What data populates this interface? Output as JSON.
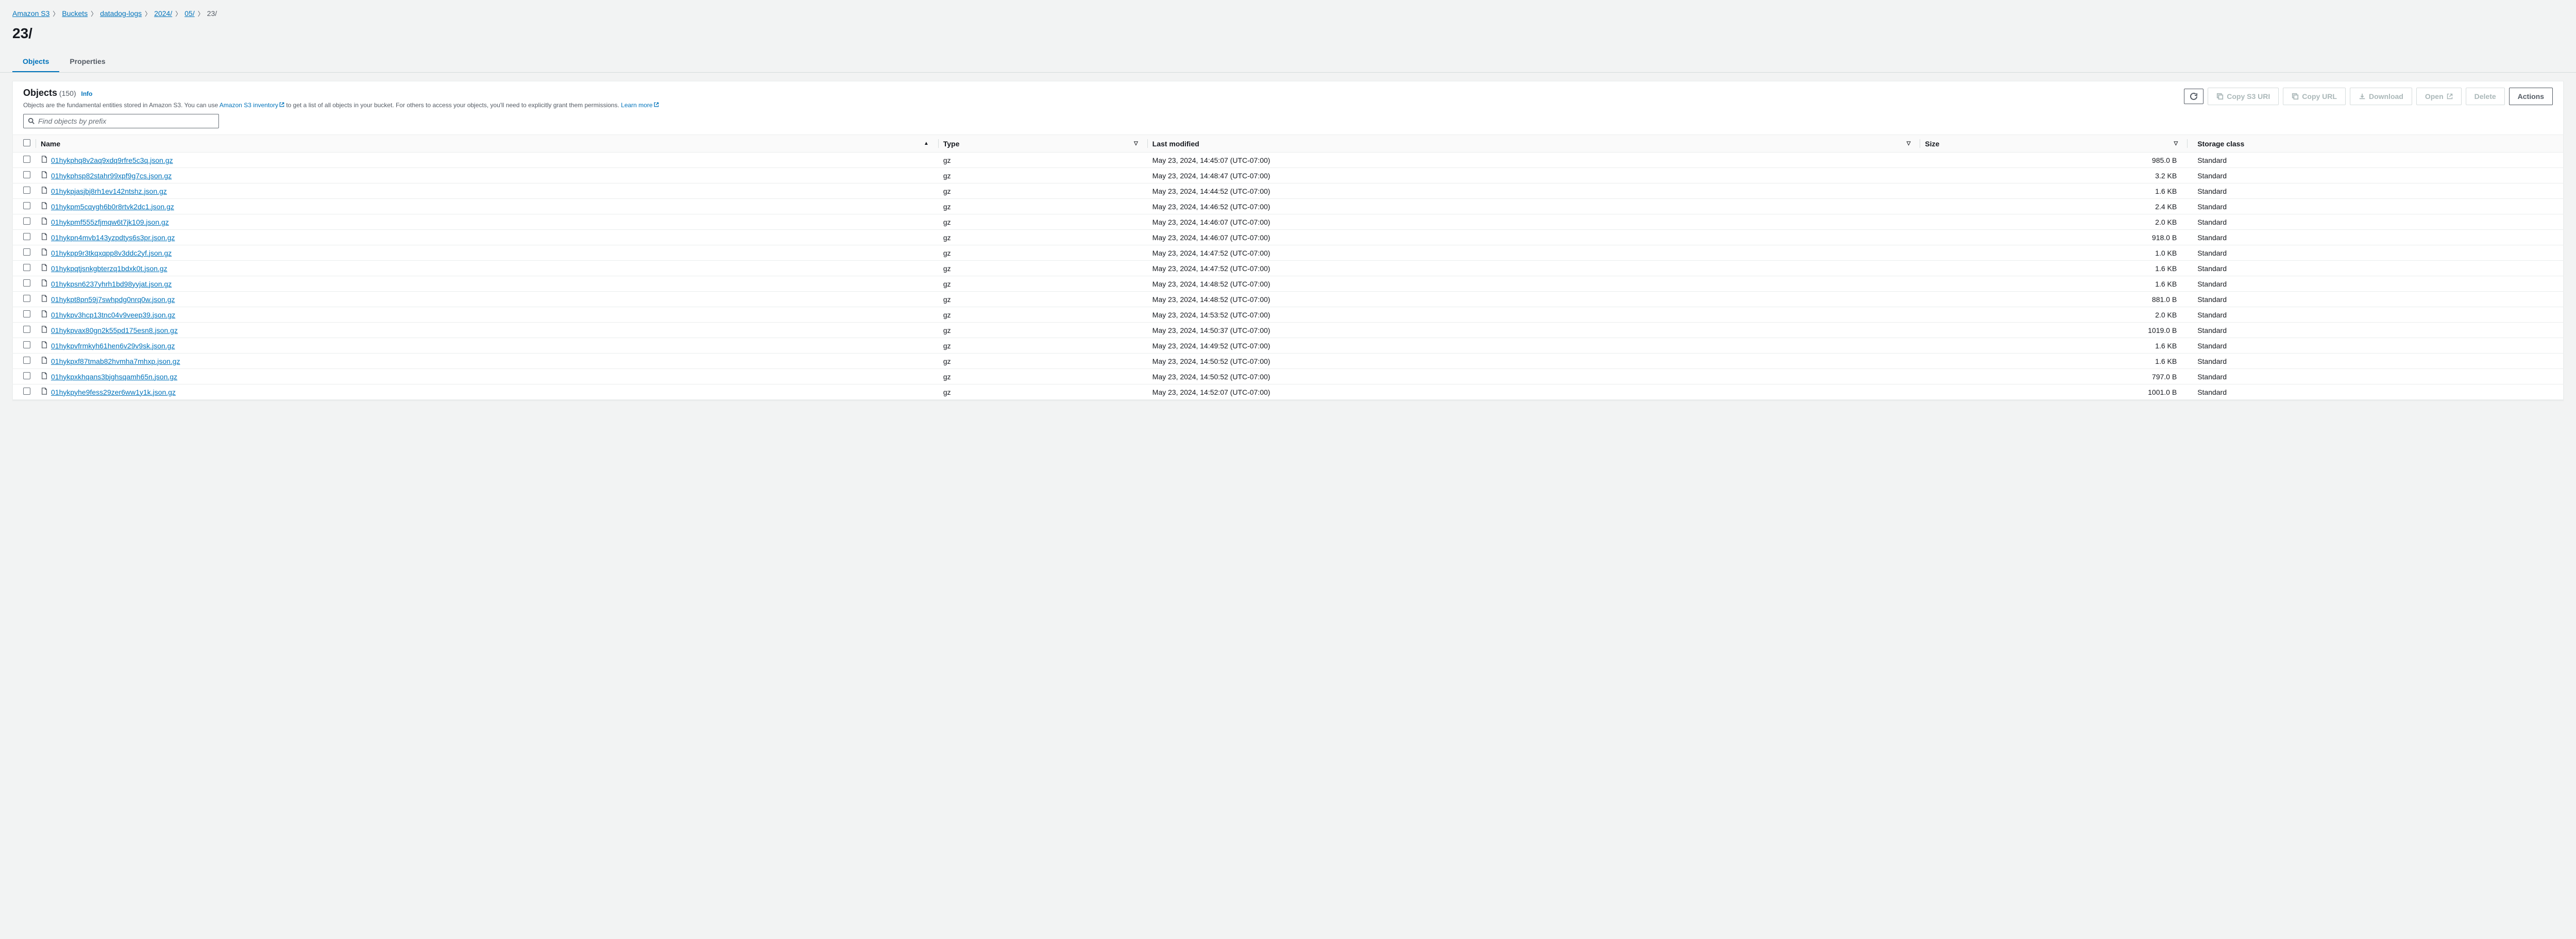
{
  "breadcrumb": [
    {
      "label": "Amazon S3",
      "link": true
    },
    {
      "label": "Buckets",
      "link": true
    },
    {
      "label": "datadog-logs",
      "link": true
    },
    {
      "label": "2024/",
      "link": true
    },
    {
      "label": "05/",
      "link": true
    },
    {
      "label": "23/",
      "link": false
    }
  ],
  "page_title": "23/",
  "tabs": {
    "objects": "Objects",
    "properties": "Properties"
  },
  "panel": {
    "title": "Objects",
    "count": "(150)",
    "info": "Info",
    "desc_pre": "Objects are the fundamental entities stored in Amazon S3. You can use ",
    "desc_link1": "Amazon S3 inventory",
    "desc_mid": " to get a list of all objects in your bucket. For others to access your objects, you'll need to explicitly grant them permissions. ",
    "desc_link2": "Learn more"
  },
  "actions": {
    "copy_s3_uri": "Copy S3 URI",
    "copy_url": "Copy URL",
    "download": "Download",
    "open": "Open",
    "delete": "Delete",
    "actions": "Actions"
  },
  "search": {
    "placeholder": "Find objects by prefix"
  },
  "columns": {
    "name": "Name",
    "type": "Type",
    "last_modified": "Last modified",
    "size": "Size",
    "storage_class": "Storage class"
  },
  "rows": [
    {
      "name": "01hykphq8v2aq9xdq9rfre5c3q.json.gz",
      "type": "gz",
      "modified": "May 23, 2024, 14:45:07 (UTC-07:00)",
      "size": "985.0 B",
      "storage": "Standard"
    },
    {
      "name": "01hykphsp82stahr99xpf9g7cs.json.gz",
      "type": "gz",
      "modified": "May 23, 2024, 14:48:47 (UTC-07:00)",
      "size": "3.2 KB",
      "storage": "Standard"
    },
    {
      "name": "01hykpjasjbj8rh1ev142ntshz.json.gz",
      "type": "gz",
      "modified": "May 23, 2024, 14:44:52 (UTC-07:00)",
      "size": "1.6 KB",
      "storage": "Standard"
    },
    {
      "name": "01hykpm5cqygh6b0r8rtvk2dc1.json.gz",
      "type": "gz",
      "modified": "May 23, 2024, 14:46:52 (UTC-07:00)",
      "size": "2.4 KB",
      "storage": "Standard"
    },
    {
      "name": "01hykpmf555zfjmqw6t7jk109.json.gz",
      "type": "gz",
      "modified": "May 23, 2024, 14:46:07 (UTC-07:00)",
      "size": "2.0 KB",
      "storage": "Standard"
    },
    {
      "name": "01hykpn4mvb143yzpdtys6s3pr.json.gz",
      "type": "gz",
      "modified": "May 23, 2024, 14:46:07 (UTC-07:00)",
      "size": "918.0 B",
      "storage": "Standard"
    },
    {
      "name": "01hykpp9r3tkqxqpp8v3ddc2yf.json.gz",
      "type": "gz",
      "modified": "May 23, 2024, 14:47:52 (UTC-07:00)",
      "size": "1.0 KB",
      "storage": "Standard"
    },
    {
      "name": "01hykpqtjsnkgbterzq1bdxk0t.json.gz",
      "type": "gz",
      "modified": "May 23, 2024, 14:47:52 (UTC-07:00)",
      "size": "1.6 KB",
      "storage": "Standard"
    },
    {
      "name": "01hykpsn6237yhrh1bd98yyjat.json.gz",
      "type": "gz",
      "modified": "May 23, 2024, 14:48:52 (UTC-07:00)",
      "size": "1.6 KB",
      "storage": "Standard"
    },
    {
      "name": "01hykpt8pn59j7swhpdg0nrq0w.json.gz",
      "type": "gz",
      "modified": "May 23, 2024, 14:48:52 (UTC-07:00)",
      "size": "881.0 B",
      "storage": "Standard"
    },
    {
      "name": "01hykpv3hcp13tnc04v9veep39.json.gz",
      "type": "gz",
      "modified": "May 23, 2024, 14:53:52 (UTC-07:00)",
      "size": "2.0 KB",
      "storage": "Standard"
    },
    {
      "name": "01hykpvax80gn2k55pd175esn8.json.gz",
      "type": "gz",
      "modified": "May 23, 2024, 14:50:37 (UTC-07:00)",
      "size": "1019.0 B",
      "storage": "Standard"
    },
    {
      "name": "01hykpvfrmkyh61hen6v29v9sk.json.gz",
      "type": "gz",
      "modified": "May 23, 2024, 14:49:52 (UTC-07:00)",
      "size": "1.6 KB",
      "storage": "Standard"
    },
    {
      "name": "01hykpxf87tmab82hvmha7mhxp.json.gz",
      "type": "gz",
      "modified": "May 23, 2024, 14:50:52 (UTC-07:00)",
      "size": "1.6 KB",
      "storage": "Standard"
    },
    {
      "name": "01hykpxkhqans3bjghsqamh65n.json.gz",
      "type": "gz",
      "modified": "May 23, 2024, 14:50:52 (UTC-07:00)",
      "size": "797.0 B",
      "storage": "Standard"
    },
    {
      "name": "01hykpyhe9fess29zer6ww1y1k.json.gz",
      "type": "gz",
      "modified": "May 23, 2024, 14:52:07 (UTC-07:00)",
      "size": "1001.0 B",
      "storage": "Standard"
    }
  ]
}
